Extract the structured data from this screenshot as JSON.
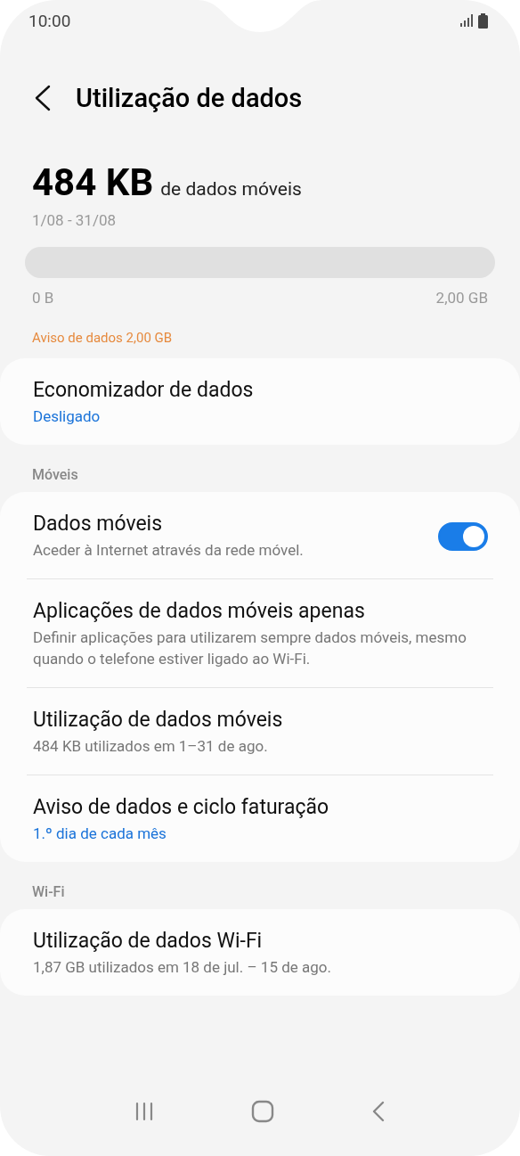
{
  "status_bar": {
    "time": "10:00"
  },
  "header": {
    "title": "Utilização de dados"
  },
  "usage": {
    "amount": "484 KB",
    "unit_label": "de dados móveis",
    "period": "1/08 - 31/08",
    "level": 0,
    "min_label": "0 B",
    "max_label": "2,00 GB",
    "warning": "Aviso de dados 2,00 GB"
  },
  "sections": [
    {
      "items": [
        {
          "kind": "plain",
          "title": "Economizador de dados",
          "subtitle": "Desligado",
          "highlight": true
        }
      ]
    },
    {
      "heading": "Móveis",
      "items": [
        {
          "kind": "switch",
          "title": "Dados móveis",
          "subtitle": "Aceder à Internet através da rede móvel.",
          "highlight": false,
          "on": true
        },
        {
          "kind": "plain",
          "title": "Aplicações de dados móveis apenas",
          "subtitle": "Definir aplicações para utilizarem sempre dados móveis, mesmo quando o telefone estiver ligado ao Wi-Fi.",
          "highlight": false
        },
        {
          "kind": "plain",
          "title": "Utilização de dados móveis",
          "subtitle": "484 KB utilizados em 1–31 de ago.",
          "highlight": false
        },
        {
          "kind": "plain",
          "title": "Aviso de dados e ciclo faturação",
          "subtitle": "1.º dia de cada mês",
          "highlight": true
        }
      ]
    },
    {
      "heading": "Wi-Fi",
      "items": [
        {
          "kind": "plain",
          "title": "Utilização de dados Wi-Fi",
          "subtitle": "1,87 GB utilizados em 18 de jul. – 15 de ago.",
          "highlight": false
        }
      ]
    }
  ]
}
